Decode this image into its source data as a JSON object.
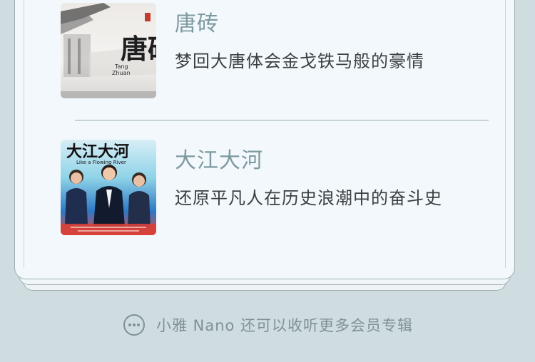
{
  "albums": [
    {
      "title": "唐砖",
      "description": "梦回大唐体会金戈铁马般的豪情",
      "cover_icon": "tang-zhuan-cover",
      "cover_text": {
        "calligraphy": "唐磚",
        "tang": "Tang",
        "zhuan": "Zhuan"
      }
    },
    {
      "title": "大江大河",
      "description": "还原平凡人在历史浪潮中的奋斗史",
      "cover_icon": "da-jiang-da-he-cover",
      "cover_text": {
        "title": "大江大河",
        "subtitle": "Like a Flowing River"
      }
    }
  ],
  "more": {
    "icon": "ellipsis-circle-icon",
    "label": "小雅 Nano 还可以收听更多会员专辑"
  },
  "colors": {
    "background": "#cfdde0",
    "card": "#f2f8fb",
    "title": "#7d9aa0",
    "description": "#3b3f41",
    "more_text": "#7f9193"
  }
}
